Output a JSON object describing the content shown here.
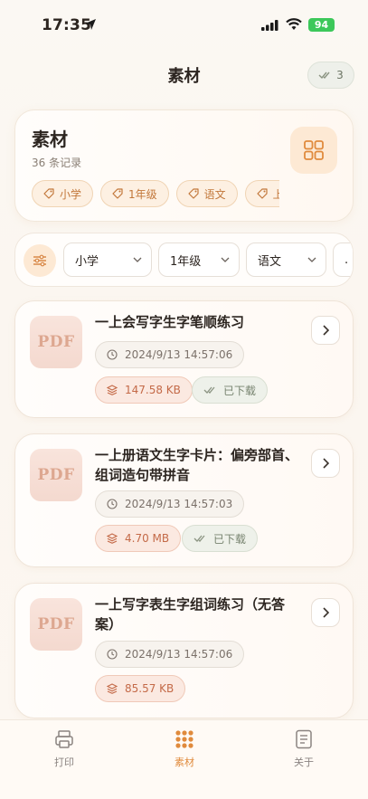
{
  "status": {
    "time": "17:35",
    "battery": "94"
  },
  "nav": {
    "title": "素材",
    "badge_count": "3"
  },
  "header": {
    "title": "素材",
    "count": "36 条记录",
    "tags": [
      "小学",
      "1年级",
      "语文",
      "上册"
    ]
  },
  "filters": {
    "selects": [
      {
        "value": "小学"
      },
      {
        "value": "1年级"
      },
      {
        "value": "语文"
      },
      {
        "value": "."
      }
    ]
  },
  "items": [
    {
      "thumb": "PDF",
      "title": "一上会写字生字笔顺练习",
      "time": "2024/9/13 14:57:06",
      "size": "147.58 KB",
      "status": "已下载"
    },
    {
      "thumb": "PDF",
      "title": "一上册语文生字卡片：偏旁部首、组词造句带拼音",
      "time": "2024/9/13 14:57:03",
      "size": "4.70 MB",
      "status": "已下载"
    },
    {
      "thumb": "PDF",
      "title": "一上写字表生字组词练习（无答案）",
      "time": "2024/9/13 14:57:06",
      "size": "85.57 KB",
      "status": ""
    }
  ],
  "tabs": [
    {
      "label": "打印",
      "icon": "printer-icon"
    },
    {
      "label": "素材",
      "icon": "grid-dots-icon",
      "active": true
    },
    {
      "label": "关于",
      "icon": "document-icon"
    }
  ],
  "colors": {
    "accent": "#e08a3c",
    "tag_text": "#c2773a",
    "size_text": "#c46a48",
    "downloaded_text": "#788470"
  }
}
